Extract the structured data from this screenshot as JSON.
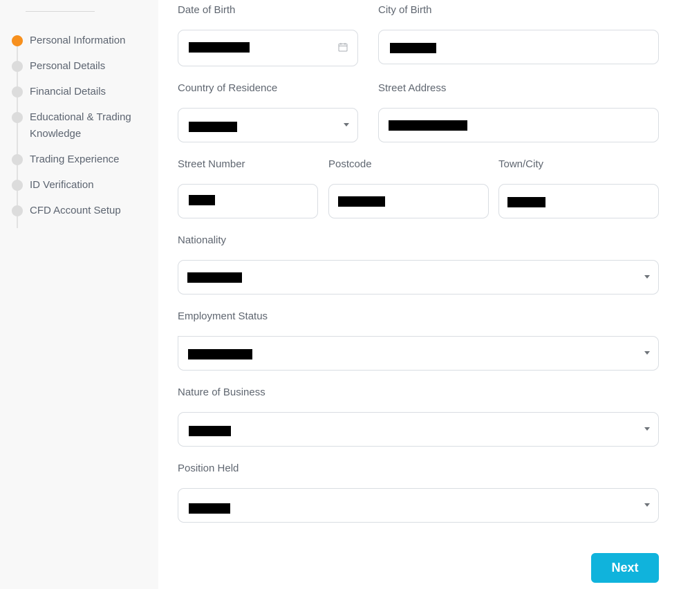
{
  "steps": [
    {
      "label": "Personal Information",
      "active": true
    },
    {
      "label": "Personal Details",
      "active": false
    },
    {
      "label": "Financial Details",
      "active": false
    },
    {
      "label": "Educational & Trading Knowledge",
      "active": false
    },
    {
      "label": "Trading Experience",
      "active": false
    },
    {
      "label": "ID Verification",
      "active": false
    },
    {
      "label": "CFD Account Setup",
      "active": false
    }
  ],
  "form": {
    "date_of_birth": {
      "label": "Date of Birth",
      "value": "[redacted]"
    },
    "city_of_birth": {
      "label": "City of Birth",
      "value": "[redacted]"
    },
    "country_of_residence": {
      "label": "Country of Residence",
      "value": "[redacted]"
    },
    "street_address": {
      "label": "Street Address",
      "value": "[redacted]"
    },
    "street_number": {
      "label": "Street Number",
      "value": "[redacted]"
    },
    "postcode": {
      "label": "Postcode",
      "value": "[redacted]"
    },
    "town_city": {
      "label": "Town/City",
      "value": "[redacted]"
    },
    "nationality": {
      "label": "Nationality",
      "value": "[redacted]"
    },
    "employment_status": {
      "label": "Employment Status",
      "value": "[redacted]"
    },
    "nature_of_business": {
      "label": "Nature of Business",
      "value": "[redacted]"
    },
    "position_held": {
      "label": "Position Held",
      "value": "[redacted]"
    }
  },
  "actions": {
    "next_label": "Next"
  },
  "colors": {
    "accent": "#f7901e",
    "primary_button": "#10b3dc",
    "inactive_dot": "#dcdcdc"
  },
  "icons": {
    "calendar": "calendar-icon",
    "dropdown": "chevron-down-icon"
  }
}
